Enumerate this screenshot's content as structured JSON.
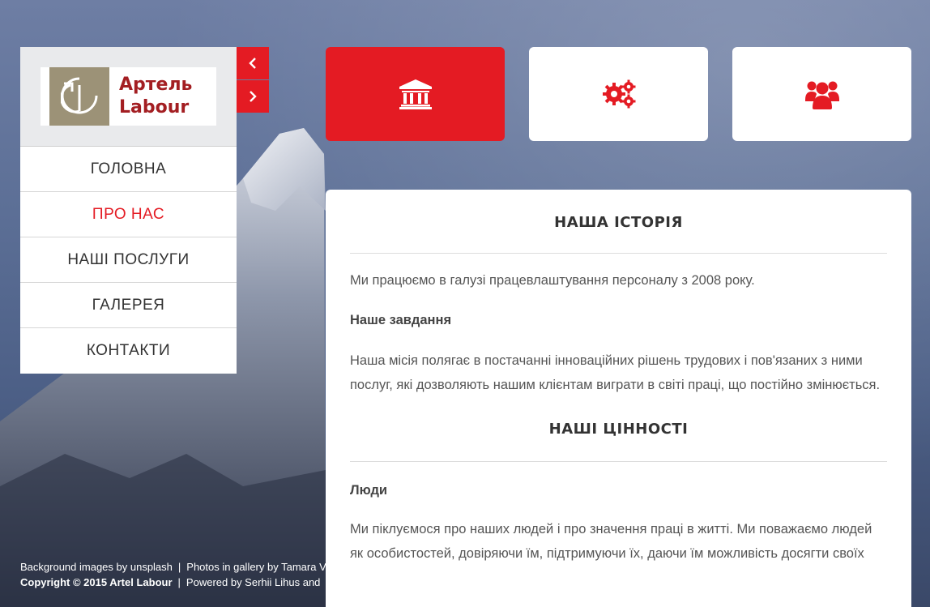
{
  "brand": {
    "logo_line1": "Артель",
    "logo_line2": "Labour",
    "logo_color": "#a31e22"
  },
  "accent_color": "#e41b23",
  "nav": {
    "items": [
      {
        "label": "ГОЛОВНА",
        "active": false
      },
      {
        "label": "ПРО НАС",
        "active": true
      },
      {
        "label": "НАШІ ПОСЛУГИ",
        "active": false
      },
      {
        "label": "ГАЛЕРЕЯ",
        "active": false
      },
      {
        "label": "КОНТАКТИ",
        "active": false
      }
    ],
    "prev_icon": "chevron-left-icon",
    "next_icon": "chevron-right-icon"
  },
  "tiles": [
    {
      "icon": "bank-icon",
      "active": true
    },
    {
      "icon": "gears-icon",
      "active": false
    },
    {
      "icon": "users-icon",
      "active": false
    }
  ],
  "content": {
    "history_title": "НАША ІСТОРІЯ",
    "history_text": "Ми працюємо в галузі працевлаштування персоналу з 2008 року.",
    "task_title": "Наше завдання",
    "task_text": "Наша місія полягає в постачанні інноваційних рішень трудових і пов'язаних з ними послуг, які дозволяють нашим клієнтам виграти в світі праці, що постійно змінюється.",
    "values_title": "НАШІ ЦІННОСТІ",
    "people_title": "Люди",
    "people_text": "Ми піклуємося про наших людей і про значення праці в житті. Ми поважаємо людей як особистостей, довіряючи їм, підтримуючи їх, даючи їм можливість досягти своїх"
  },
  "footer": {
    "line1_a": "Background images by unsplash",
    "line1_b": "Photos in gallery by Tamara V",
    "line2_a": "Copyright © 2015 Artel Labour",
    "line2_b": "Powered by Serhii Lihus and",
    "separator": "|"
  }
}
